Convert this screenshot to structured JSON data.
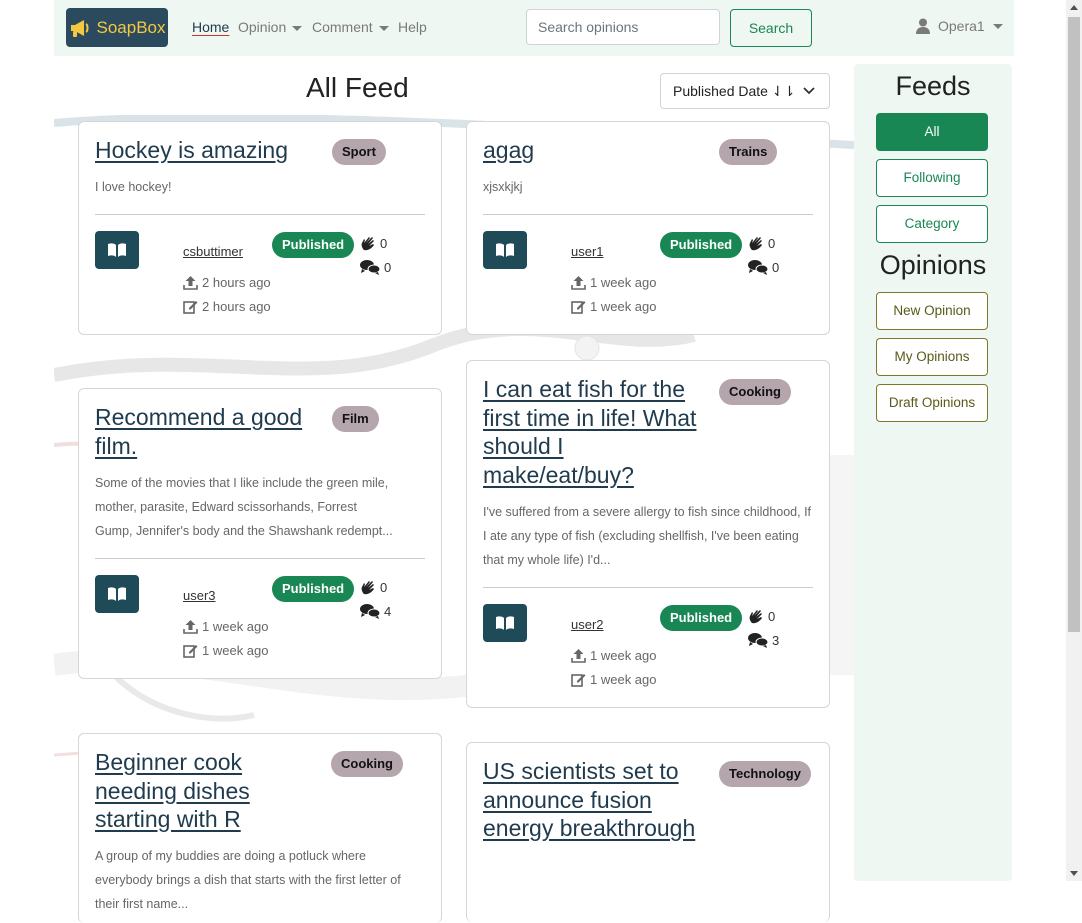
{
  "navbar": {
    "brand": "SoapBox",
    "links": {
      "home": "Home",
      "opinion": "Opinion",
      "comment": "Comment",
      "help": "Help"
    },
    "search_placeholder": "Search opinions",
    "search_button": "Search",
    "username": "Opera1"
  },
  "main": {
    "title": "All Feed",
    "sort_value": "Published Date ⇃⇂"
  },
  "cards": [
    {
      "title": "Hockey is amazing",
      "category": "Sport",
      "excerpt": "I love hockey!",
      "author": "csbuttimer",
      "status": "Published",
      "published": "2 hours ago",
      "edited": "2 hours ago",
      "claps": "0",
      "comments": "0"
    },
    {
      "title": "agag",
      "category": "Trains",
      "excerpt": "xjsxkjkj",
      "author": "user1",
      "status": "Published",
      "published": "1 week ago",
      "edited": "1 week ago",
      "claps": "0",
      "comments": "0"
    },
    {
      "title": "Recommend a good film.",
      "category": "Film",
      "excerpt": "Some of the movies that I like include the green mile, mother, parasite, Edward scissorhands, Forrest Gump, Jennifer's body and the Shawshank redempt...",
      "author": "user3",
      "status": "Published",
      "published": "1 week ago",
      "edited": "1 week ago",
      "claps": "0",
      "comments": "4"
    },
    {
      "title": "I can eat fish for the first time in life! What should I make/eat/buy?",
      "category": "Cooking",
      "excerpt": "I've suffered from a severe allergy to fish since childhood, If I ate any type of fish (excluding shellfish, I've been eating that my whole life) I'd...",
      "author": "user2",
      "status": "Published",
      "published": "1 week ago",
      "edited": "1 week ago",
      "claps": "0",
      "comments": "3"
    },
    {
      "title": "Beginner cook needing dishes starting with R",
      "category": "Cooking",
      "excerpt": "A group of my buddies are doing a potluck where everybody brings a dish that starts with the first letter of their first name..."
    },
    {
      "title": "US scientists set to announce fusion energy breakthrough",
      "category": "Technology"
    }
  ],
  "sidebar": {
    "feeds_heading": "Feeds",
    "feeds": {
      "all": "All",
      "following": "Following",
      "category": "Category"
    },
    "opinions_heading": "Opinions",
    "opinions": {
      "new": "New Opinion",
      "mine": "My Opinions",
      "drafts": "Draft Opinions"
    }
  },
  "colors": {
    "brand_bg": "#2c4a5e",
    "brand_text": "#f5c842",
    "success": "#198754",
    "category_badge": "#b5a5ad",
    "read_button": "#1f4a58",
    "nav_bg": "#eef7f2"
  },
  "icons": [
    "megaphone-icon",
    "user-icon",
    "book-open-icon",
    "upload-icon",
    "edit-icon",
    "clap-icon",
    "comments-icon",
    "sort-arrows-icon",
    "chevron-down-icon"
  ]
}
